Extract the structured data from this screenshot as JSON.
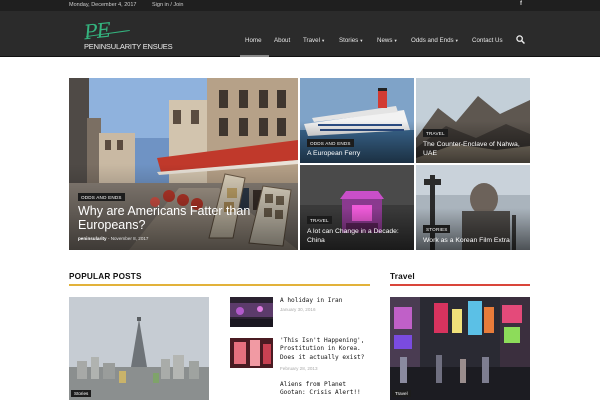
{
  "topbar": {
    "date": "Monday, December 4, 2017",
    "signin": "Sign in / Join",
    "facebook_glyph": "f"
  },
  "header": {
    "logo_mark": "PE",
    "logo_name": "PENINSULARITY ENSUES"
  },
  "nav": {
    "items": [
      {
        "label": "Home",
        "dropdown": false
      },
      {
        "label": "About",
        "dropdown": false
      },
      {
        "label": "Travel",
        "dropdown": true
      },
      {
        "label": "Stories",
        "dropdown": true
      },
      {
        "label": "News",
        "dropdown": true
      },
      {
        "label": "Odds and Ends",
        "dropdown": true
      },
      {
        "label": "Contact Us",
        "dropdown": false
      }
    ],
    "caret": "▾",
    "search_icon": "search-icon"
  },
  "hero": {
    "big": {
      "tag": "ODDS AND ENDS",
      "title": "Why are Americans Fatter than Europeans?",
      "author": "peninsularity",
      "meta_sep": " - ",
      "date": "November 8, 2017"
    },
    "tiles": [
      {
        "tag": "ODDS AND ENDS",
        "title": "A European Ferry"
      },
      {
        "tag": "TRAVEL",
        "title": "The Counter-Enclave of Nahwa, UAE"
      },
      {
        "tag": "TRAVEL",
        "title": "A lot can Change in a Decade: China"
      },
      {
        "tag": "STORIES",
        "title": "Work as a Korean Film Extra"
      }
    ]
  },
  "popular": {
    "heading": "POPULAR POSTS",
    "accent": "#e2b23a",
    "feature_tag": "Stories",
    "posts": [
      {
        "title": "A holiday in Iran",
        "date": "January 30, 2016"
      },
      {
        "title": "'This Isn't Happening', Prostitution in Korea. Does it actually exist?",
        "date": "February 28, 2013"
      },
      {
        "title": "Aliens from Planet Gootan: Crisis Alert!!",
        "date": ""
      }
    ]
  },
  "travel": {
    "heading": "Travel",
    "accent": "#d9453a",
    "feature_tag": "Travel"
  }
}
